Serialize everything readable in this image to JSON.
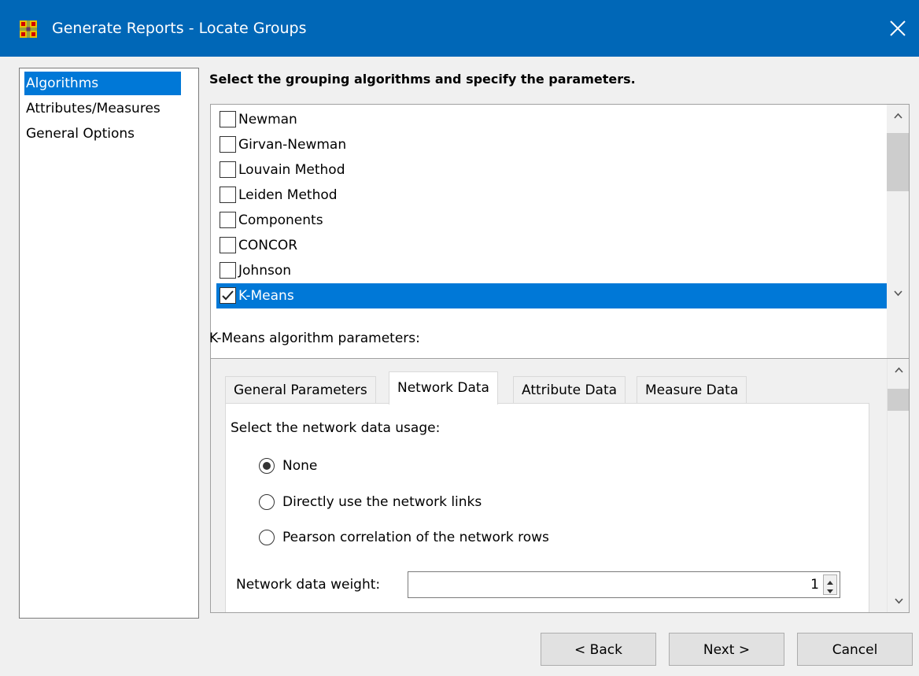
{
  "window": {
    "title": "Generate Reports - Locate Groups",
    "app_icon": "grid-app-icon",
    "close_icon": "close-icon",
    "accent_color": "#0067b7"
  },
  "sidebar": {
    "items": [
      {
        "label": "Algorithms",
        "selected": true
      },
      {
        "label": "Attributes/Measures",
        "selected": false
      },
      {
        "label": "General Options",
        "selected": false
      }
    ]
  },
  "algorithms": {
    "heading": "Select the grouping algorithms and specify the parameters.",
    "items": [
      {
        "label": "Newman",
        "checked": false
      },
      {
        "label": "Girvan-Newman",
        "checked": false
      },
      {
        "label": "Louvain Method",
        "checked": false
      },
      {
        "label": "Leiden Method",
        "checked": false
      },
      {
        "label": "Components",
        "checked": false
      },
      {
        "label": "CONCOR",
        "checked": false
      },
      {
        "label": "Johnson",
        "checked": false
      },
      {
        "label": "K-Means",
        "checked": true,
        "selected": true
      }
    ]
  },
  "parameters": {
    "label": "K-Means algorithm parameters:",
    "tabs": [
      {
        "label": "General Parameters",
        "active": false
      },
      {
        "label": "Network Data",
        "active": true
      },
      {
        "label": "Attribute Data",
        "active": false
      },
      {
        "label": "Measure Data",
        "active": false
      }
    ],
    "network_data": {
      "usage_label": "Select the network data usage:",
      "options": [
        {
          "label": "None",
          "checked": true
        },
        {
          "label": "Directly use the network links",
          "checked": false
        },
        {
          "label": "Pearson correlation of the network rows",
          "checked": false
        }
      ],
      "weight_label": "Network data weight:",
      "weight_value": "1"
    }
  },
  "buttons": {
    "back": "< Back",
    "next": "Next >",
    "cancel": "Cancel"
  }
}
